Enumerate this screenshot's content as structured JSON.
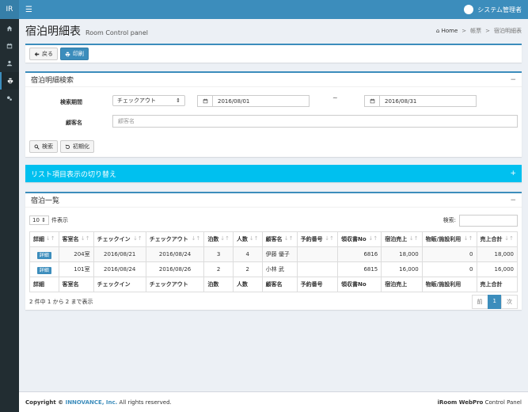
{
  "sidebar": {
    "logo": "IR"
  },
  "topbar": {
    "user_name": "システム管理者"
  },
  "header": {
    "title": "宿泊明細表",
    "subtitle": "Room Control panel",
    "breadcrumb": [
      "Home",
      "帳票",
      "宿泊明細表"
    ]
  },
  "actions": {
    "back_label": "戻る",
    "print_label": "印刷"
  },
  "search": {
    "title": "宿泊明細検索",
    "period_label": "検索期間",
    "period_type": "チェックアウト",
    "date_from": "2016/08/01",
    "tilde": "~",
    "date_to": "2016/08/31",
    "customer_label": "顧客名",
    "customer_placeholder": "顧客名",
    "search_button": "検索",
    "reset_button": "初期化"
  },
  "toggle": {
    "title": "リスト項目表示の切り替え",
    "icon": "+"
  },
  "list": {
    "title": "宿泊一覧",
    "length_value": "10",
    "length_suffix": "件表示",
    "search_label": "検索:",
    "columns": [
      "詳細",
      "客室名",
      "チェックイン",
      "チェックアウト",
      "泊数",
      "人数",
      "顧客名",
      "予約番号",
      "領収書No",
      "宿泊売上",
      "物販/施設利用",
      "売上合計"
    ],
    "rows": [
      {
        "detail": "詳細",
        "room": "204室",
        "checkin": "2016/08/21",
        "checkout": "2016/08/24",
        "nights": "3",
        "people": "4",
        "customer": "伊藤 優子",
        "reservation": "",
        "receipt": "6816",
        "stay_sales": "18,000",
        "other": "0",
        "total": "18,000"
      },
      {
        "detail": "詳細",
        "room": "101室",
        "checkin": "2016/08/24",
        "checkout": "2016/08/26",
        "nights": "2",
        "people": "2",
        "customer": "小林 武",
        "reservation": "",
        "receipt": "6815",
        "stay_sales": "16,000",
        "other": "0",
        "total": "16,000"
      }
    ],
    "info": "2 件中 1 から 2 まで表示",
    "prev": "前",
    "page": "1",
    "next": "次"
  },
  "footer": {
    "copyright_prefix": "Copyright © ",
    "company": "INNOVANCE, Inc.",
    "rights": " All rights reserved.",
    "product_bold": "iRoom WebPro",
    "product_rest": " Control Panel"
  }
}
